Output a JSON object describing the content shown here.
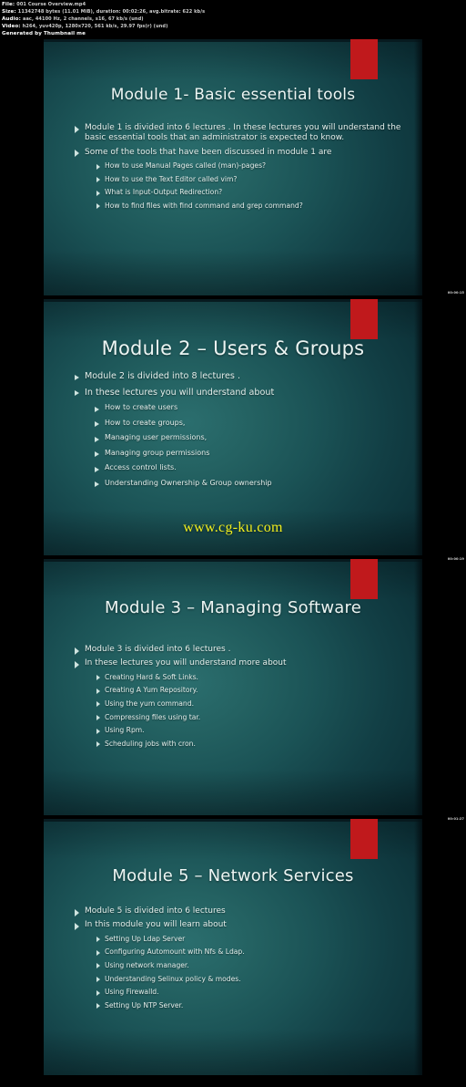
{
  "meta": {
    "file_label": "File:",
    "file_value": "001 Course Overview.mp4",
    "size_label": "Size:",
    "size_value": "11342748 bytes (11.01 MiB), duration: 00:02:26, avg.bitrate: 622 kb/s",
    "audio_label": "Audio:",
    "audio_value": "aac, 44100 Hz, 2 channels, s16, 67 kb/s (und)",
    "video_label": "Video:",
    "video_value": "h264, yuv420p, 1280x720, 561 kb/s, 29.97 fps(r) (und)",
    "generator": "Generated by Thumbnail me"
  },
  "timestamps": [
    "00:00:15",
    "00:00:19",
    "00:01:27"
  ],
  "watermark": "www.cg-ku.com",
  "colors": {
    "accent_red": "#c0191c",
    "slide_teal": "#1b5356",
    "watermark_yellow": "#f2ef1e",
    "text": "#eaf4f2"
  },
  "slides": [
    {
      "title": "Module 1- Basic essential tools",
      "bullets": [
        {
          "level": 1,
          "text": "Module 1 is divided  into 6 lectures . In these lectures you will understand the basic essential tools that an administrator is expected  to know."
        },
        {
          "level": 1,
          "text": "Some of the tools that have been discussed in module 1 are"
        },
        {
          "level": 2,
          "text": "How to use Manual Pages called (man)-pages?"
        },
        {
          "level": 2,
          "text": "How to use the Text Editor called vim?"
        },
        {
          "level": 2,
          "text": "What is Input-Output Redirection?"
        },
        {
          "level": 2,
          "text": "How to find files with find command and grep command?"
        }
      ]
    },
    {
      "title": "Module 2 – Users & Groups",
      "bullets": [
        {
          "level": 1,
          "text": "Module 2 is divided into 8 lectures ."
        },
        {
          "level": 1,
          "text": "In these lectures you will understand about"
        },
        {
          "level": 2,
          "text": "How to create users"
        },
        {
          "level": 2,
          "text": "How to create groups,"
        },
        {
          "level": 2,
          "text": "Managing user permissions,"
        },
        {
          "level": 2,
          "text": "Managing group permissions"
        },
        {
          "level": 2,
          "text": "Access control lists."
        },
        {
          "level": 2,
          "text": "Understanding Ownership & Group ownership"
        }
      ]
    },
    {
      "title": "Module 3 – Managing Software",
      "bullets": [
        {
          "level": 1,
          "text": "Module 3 is divided  into 6 lectures ."
        },
        {
          "level": 1,
          "text": "In these lectures you will understand  more about"
        },
        {
          "level": 2,
          "text": "Creating Hard & Soft Links."
        },
        {
          "level": 2,
          "text": "Creating A Yum Repository."
        },
        {
          "level": 2,
          "text": "Using the yum command."
        },
        {
          "level": 2,
          "text": "Compressing files using tar."
        },
        {
          "level": 2,
          "text": "Using Rpm."
        },
        {
          "level": 2,
          "text": "Scheduling jobs with cron."
        }
      ]
    },
    {
      "title": "Module 5 – Network Services",
      "bullets": [
        {
          "level": 1,
          "text": "Module 5 is divided into 6 lectures"
        },
        {
          "level": 1,
          "text": "In this module you will learn about"
        },
        {
          "level": 2,
          "text": "Setting Up Ldap Server"
        },
        {
          "level": 2,
          "text": "Configuring Automount with Nfs & Ldap."
        },
        {
          "level": 2,
          "text": "Using network manager."
        },
        {
          "level": 2,
          "text": "Understanding Selinux policy & modes."
        },
        {
          "level": 2,
          "text": "Using Firewalld."
        },
        {
          "level": 2,
          "text": "Setting Up NTP Server."
        }
      ]
    }
  ]
}
